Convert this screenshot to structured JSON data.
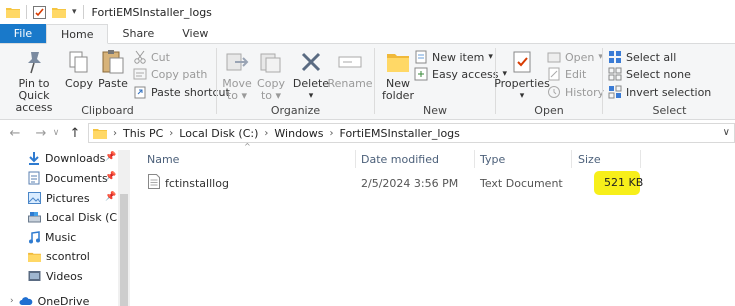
{
  "window": {
    "title": "FortiEMSInstaller_logs"
  },
  "tabs": [
    {
      "label": "File"
    },
    {
      "label": "Home"
    },
    {
      "label": "Share"
    },
    {
      "label": "View"
    }
  ],
  "ribbon": {
    "clipboard": {
      "label": "Clipboard",
      "pin": [
        "Pin to Quick",
        "access"
      ],
      "copy": "Copy",
      "paste": "Paste",
      "cut": "Cut",
      "copy_path": "Copy path",
      "paste_shortcut": "Paste shortcut"
    },
    "organize": {
      "label": "Organize",
      "move_to": [
        "Move",
        "to"
      ],
      "copy_to": [
        "Copy",
        "to"
      ],
      "delete": "Delete",
      "rename": "Rename"
    },
    "new": {
      "label": "New",
      "new_folder": [
        "New",
        "folder"
      ],
      "new_item": "New item",
      "easy_access": "Easy access"
    },
    "open": {
      "label": "Open",
      "properties": "Properties",
      "open": "Open",
      "edit": "Edit",
      "history": "History"
    },
    "select": {
      "label": "Select",
      "select_all": "Select all",
      "select_none": "Select none",
      "invert": "Invert selection"
    }
  },
  "address": {
    "crumbs": [
      "This PC",
      "Local Disk (C:)",
      "Windows",
      "FortiEMSInstaller_logs"
    ]
  },
  "navpane": {
    "items": [
      {
        "label": "Downloads",
        "icon": "download-arrow-icon",
        "pinned": true
      },
      {
        "label": "Documents",
        "icon": "documents-icon",
        "pinned": true
      },
      {
        "label": "Pictures",
        "icon": "pictures-icon",
        "pinned": true
      },
      {
        "label": "Local Disk (C:)",
        "icon": "drive-icon",
        "pinned": false
      },
      {
        "label": "Music",
        "icon": "music-icon",
        "pinned": false
      },
      {
        "label": "scontrol",
        "icon": "folder-icon",
        "pinned": false
      },
      {
        "label": "Videos",
        "icon": "videos-icon",
        "pinned": false
      },
      {
        "label": "OneDrive",
        "icon": "cloud-icon",
        "pinned": false
      }
    ]
  },
  "columns": {
    "name": "Name",
    "date": "Date modified",
    "type": "Type",
    "size": "Size"
  },
  "files": [
    {
      "name": "fctinstalllog",
      "date": "2/5/2024 3:56 PM",
      "type": "Text Document",
      "size": "521 KB"
    }
  ],
  "colors": {
    "file_tab": "#1979ca",
    "highlight": "#f7ef1a",
    "header_text": "#4c607a"
  }
}
